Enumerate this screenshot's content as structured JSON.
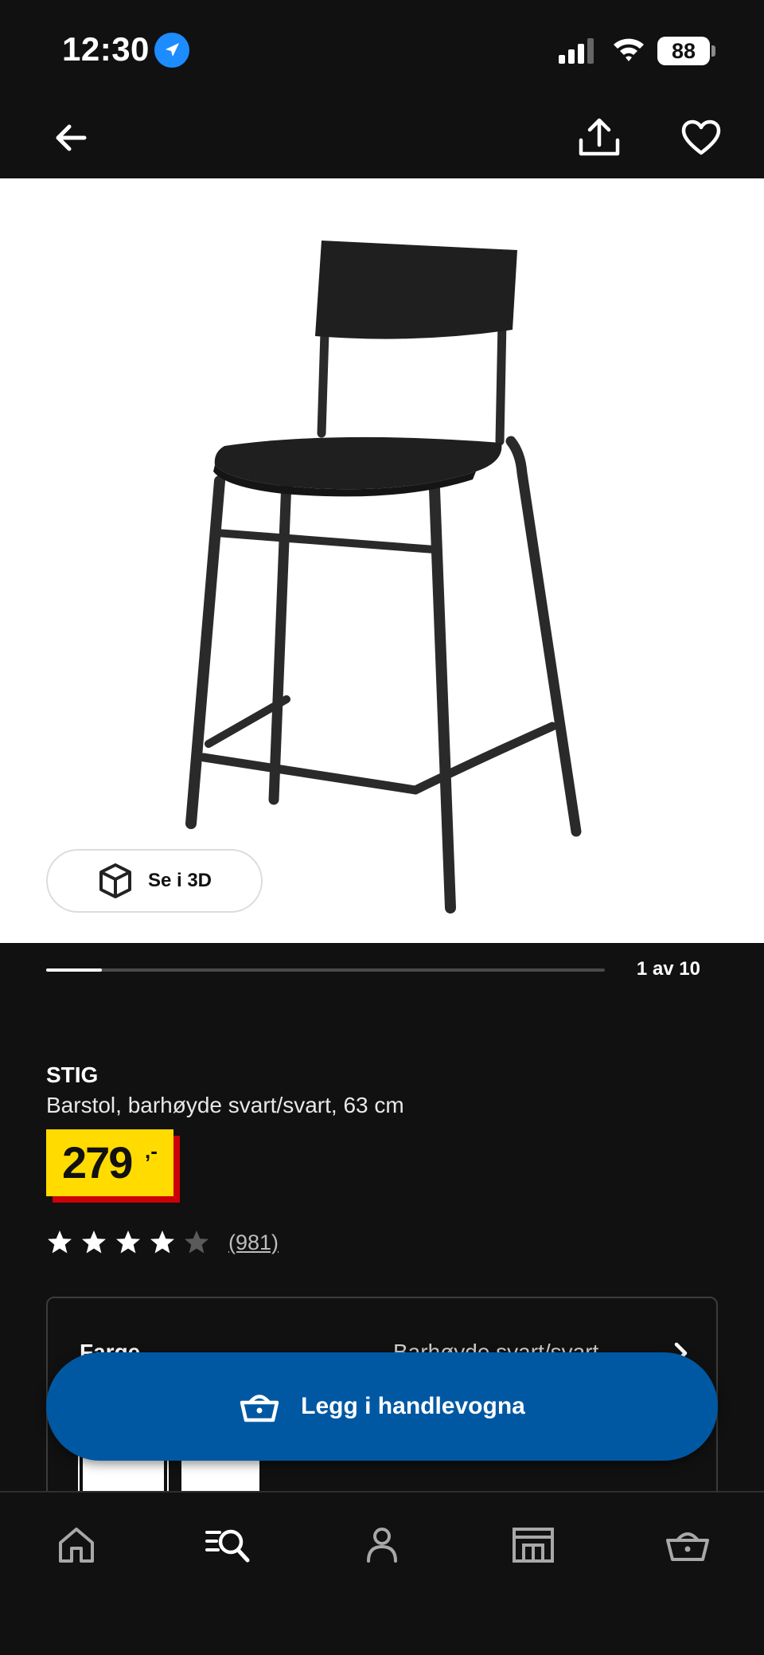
{
  "status_bar": {
    "time": "12:30",
    "battery": "88"
  },
  "icons": {
    "back": "arrow-left-icon",
    "share": "share-icon",
    "favorite": "heart-icon",
    "view_3d": "cube-icon",
    "cart": "basket-icon",
    "home": "home-icon",
    "search": "search-list-icon",
    "profile": "person-icon",
    "store": "store-icon",
    "tab_cart": "basket-icon"
  },
  "gallery": {
    "see_3d_label": "Se i 3D",
    "counter": "1 av 10",
    "current": 1,
    "total": 10
  },
  "product": {
    "name": "STIG",
    "description": "Barstol, barhøyde svart/svart, 63 cm",
    "price": "279",
    "price_suffix": ",-",
    "rating": 4,
    "rating_max": 5,
    "review_count": "(981)"
  },
  "variant": {
    "label": "Farge",
    "value": "Barhøyde svart/svart"
  },
  "cart_button": {
    "label": "Legg i handlevogna"
  },
  "colors": {
    "background": "#111111",
    "price_yellow": "#ffdb00",
    "price_red": "#cc0008",
    "button_blue": "#0058a3"
  }
}
